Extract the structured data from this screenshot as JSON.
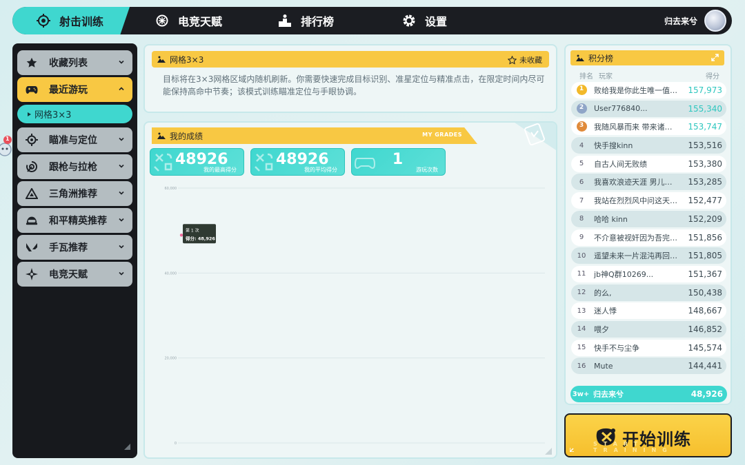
{
  "nav": {
    "items": [
      {
        "label": "射击训练",
        "icon": "target-icon"
      },
      {
        "label": "电竞天赋",
        "icon": "talent-icon"
      },
      {
        "label": "排行榜",
        "icon": "podium-icon"
      },
      {
        "label": "设置",
        "icon": "gear-icon"
      }
    ],
    "username": "归去来兮"
  },
  "sidebar": {
    "items": [
      {
        "label": "收藏列表",
        "icon": "star-icon"
      },
      {
        "label": "最近游玩",
        "icon": "gamepad-icon"
      },
      {
        "label": "瞄准与定位",
        "icon": "crosshair-icon"
      },
      {
        "label": "跟枪与拉枪",
        "icon": "tracking-icon"
      },
      {
        "label": "三角洲推荐",
        "icon": "delta-icon"
      },
      {
        "label": "和平精英推荐",
        "icon": "helmet-icon"
      },
      {
        "label": "手瓦推荐",
        "icon": "valorant-icon"
      },
      {
        "label": "电竞天赋",
        "icon": "sparkle-icon"
      }
    ],
    "sub_item": "网格3×3",
    "badge": "1"
  },
  "info": {
    "title": "网格3×3",
    "favorite": "未收藏",
    "description": "目标将在3×3网格区域内随机刷新。你需要快速完成目标识别、准星定位与精准点击，在限定时间内尽可能保持高命中节奏；该模式训练瞄准定位与手眼协调。"
  },
  "grades": {
    "title": "我的成绩",
    "title_en": "MY GRADES",
    "best_score": "48926",
    "best_label": "我的最高得分",
    "avg_score": "48926",
    "avg_label": "我的平均得分",
    "plays": "1",
    "plays_label": "游玩次数"
  },
  "chart_data": {
    "type": "line",
    "x": [
      1
    ],
    "series": [
      {
        "values": [
          48926
        ]
      }
    ],
    "ylim": [
      0,
      60000
    ],
    "yticks": [
      "60,000",
      "40,000",
      "20,000",
      "0"
    ],
    "tooltip": {
      "title": "第 1 次",
      "value": "得分: 48,926"
    },
    "grid": true,
    "accent": "#f06a9a"
  },
  "leaderboard": {
    "title": "积分榜",
    "col_rank": "排名",
    "col_player": "玩家",
    "col_score": "得分",
    "rows": [
      {
        "rank": "1",
        "name": "败给我是你此生唯一值得骄傲的事",
        "score": "157,973"
      },
      {
        "rank": "2",
        "name": "User776840...",
        "score": "155,340"
      },
      {
        "rank": "3",
        "name": "我随风暴而来 带来诸神的黄昏",
        "score": "153,747"
      },
      {
        "rank": "4",
        "name": "快手搜kinn",
        "score": "153,516"
      },
      {
        "rank": "5",
        "name": "自古人间无败绩",
        "score": "153,380"
      },
      {
        "rank": "6",
        "name": "我喜欢浪迹天涯 男儿本色",
        "score": "153,285"
      },
      {
        "rank": "7",
        "name": "我站在烈烈风中问这天地间",
        "score": "152,477"
      },
      {
        "rank": "8",
        "name": "哈哈 kinn",
        "score": "152,209"
      },
      {
        "rank": "9",
        "name": "不介意被视奸因为吾完美无缺",
        "score": "151,856"
      },
      {
        "rank": "10",
        "name": "遥望未来一片混沌再回首望",
        "score": "151,805"
      },
      {
        "rank": "11",
        "name": "jb神Q群10269...",
        "score": "151,367"
      },
      {
        "rank": "12",
        "name": "的么,",
        "score": "150,438"
      },
      {
        "rank": "13",
        "name": "迷人悸",
        "score": "148,667"
      },
      {
        "rank": "14",
        "name": "喂夕",
        "score": "146,852"
      },
      {
        "rank": "15",
        "name": "快手不与尘争",
        "score": "145,574"
      },
      {
        "rank": "16",
        "name": "Mute",
        "score": "144,441"
      }
    ],
    "me": {
      "rank": "3w+",
      "name": "归去来兮",
      "score": "48,926"
    }
  },
  "start": {
    "label": "开始训练",
    "label_en": "START TRAINING"
  },
  "colors": {
    "teal": "#3fd7cf",
    "yellow": "#f8c843",
    "dark": "#1b1d22",
    "gold": "#f2b92a",
    "silver": "#8fa5c7",
    "bronze": "#e08a3a"
  }
}
